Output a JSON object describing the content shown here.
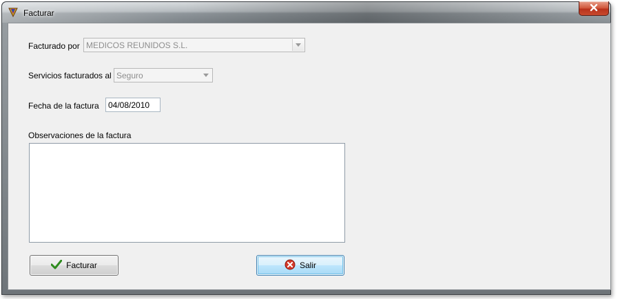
{
  "window": {
    "title": "Facturar",
    "close_icon": "close-icon",
    "app_icon": "app-logo-icon"
  },
  "form": {
    "facturado_por": {
      "label": "Facturado por",
      "value": "MEDICOS REUNIDOS S.L."
    },
    "servicios": {
      "label": "Servicios facturados al",
      "value": "Seguro"
    },
    "fecha": {
      "label": "Fecha de la factura",
      "value": "04/08/2010"
    },
    "observaciones": {
      "label": "Observaciones de la factura",
      "value": ""
    }
  },
  "buttons": {
    "facturar": {
      "label": "Facturar",
      "icon": "checkmark-icon",
      "icon_color": "#2e8b1e"
    },
    "salir": {
      "label": "Salir",
      "icon": "cancel-icon",
      "icon_color": "#d43a2a"
    }
  }
}
